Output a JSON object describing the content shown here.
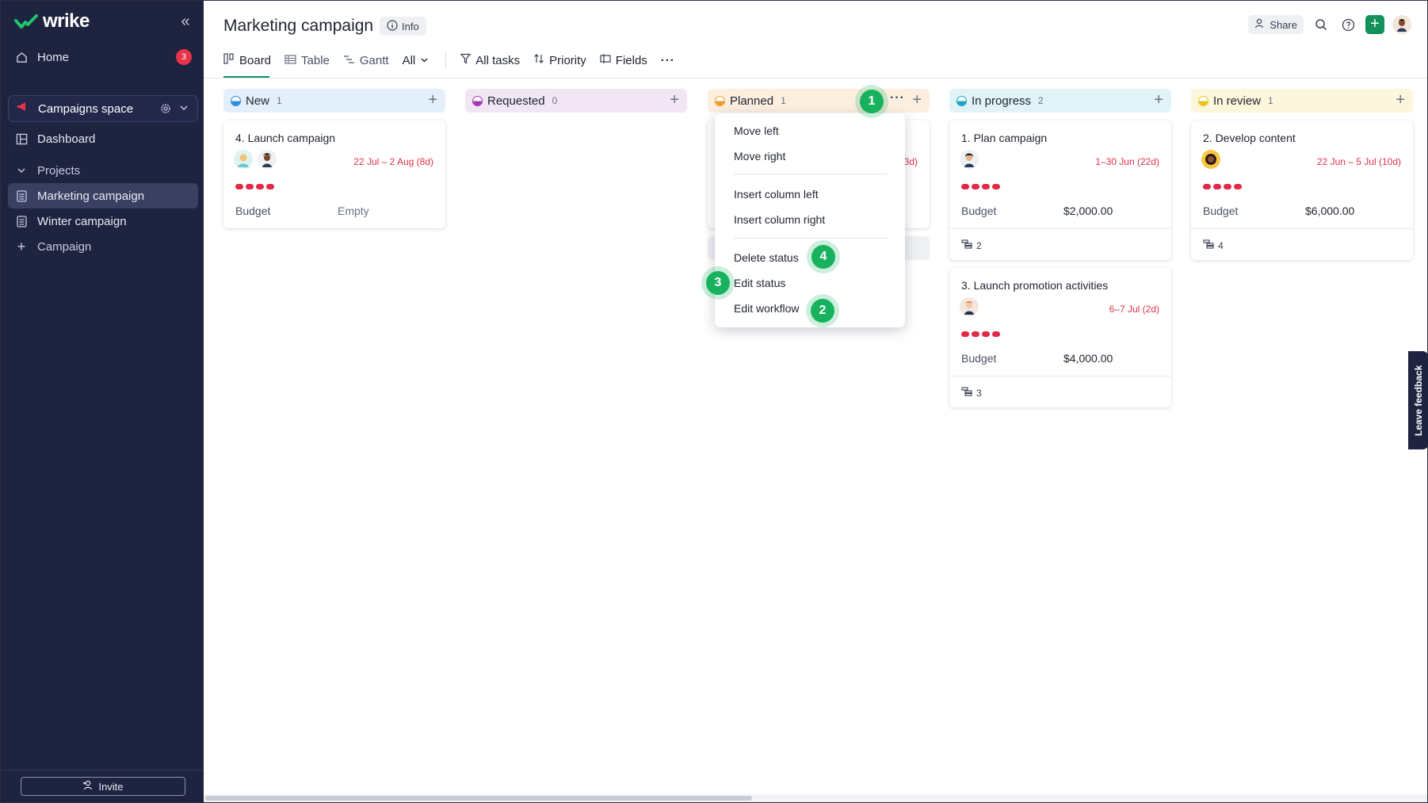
{
  "app": {
    "brand": "wrike"
  },
  "sidebar": {
    "home_label": "Home",
    "home_badge": "3",
    "space_label": "Campaigns space",
    "dashboard_label": "Dashboard",
    "projects_label": "Projects",
    "items": [
      {
        "label": "Marketing campaign",
        "active": true
      },
      {
        "label": "Winter campaign",
        "active": false
      }
    ],
    "add_label": "Campaign",
    "invite_label": "Invite"
  },
  "header": {
    "title": "Marketing campaign",
    "info_label": "Info",
    "share_label": "Share"
  },
  "toolbar": {
    "board": "Board",
    "table": "Table",
    "gantt": "Gantt",
    "filter_scope": "All",
    "all_tasks": "All tasks",
    "priority": "Priority",
    "fields": "Fields"
  },
  "columns": [
    {
      "name": "New",
      "count": "1",
      "bg": "#e3effb",
      "dot": "#2f8fe0"
    },
    {
      "name": "Requested",
      "count": "0",
      "bg": "#f3e6f4",
      "dot": "#a23bb0"
    },
    {
      "name": "Planned",
      "count": "1",
      "bg": "#fcefe0",
      "dot": "#f29a2e"
    },
    {
      "name": "In progress",
      "count": "2",
      "bg": "#e1f3f6",
      "dot": "#1aa7c4"
    },
    {
      "name": "In review",
      "count": "1",
      "bg": "#fcf6dc",
      "dot": "#e8c51d"
    }
  ],
  "cards": {
    "launch": {
      "title": "4. Launch campaign",
      "date": "22 Jul – 2 Aug (8d)",
      "field": "Budget",
      "value": "Empty"
    },
    "planned_hidden_date": "3d)",
    "plan": {
      "title": "1. Plan campaign",
      "date": "1–30 Jun (22d)",
      "field": "Budget",
      "value": "$2,000.00",
      "subtasks": "2"
    },
    "promo": {
      "title": "3. Launch promotion activities",
      "date": "6–7 Jul (2d)",
      "field": "Budget",
      "value": "$4,000.00",
      "subtasks": "3"
    },
    "develop": {
      "title": "2. Develop content",
      "date": "22 Jun – 5 Jul (10d)",
      "field": "Budget",
      "value": "$6,000.00",
      "subtasks": "4"
    }
  },
  "menu": {
    "move_left": "Move left",
    "move_right": "Move right",
    "insert_left": "Insert column left",
    "insert_right": "Insert column right",
    "delete_status": "Delete status",
    "edit_status": "Edit status",
    "edit_workflow": "Edit workflow"
  },
  "callouts": [
    "1",
    "2",
    "3",
    "4"
  ],
  "feedback_label": "Leave feedback",
  "colors": {
    "accent": "#12925a",
    "sidebar": "#1e2340",
    "due": "#e0304a",
    "callout": "#18b15e"
  }
}
